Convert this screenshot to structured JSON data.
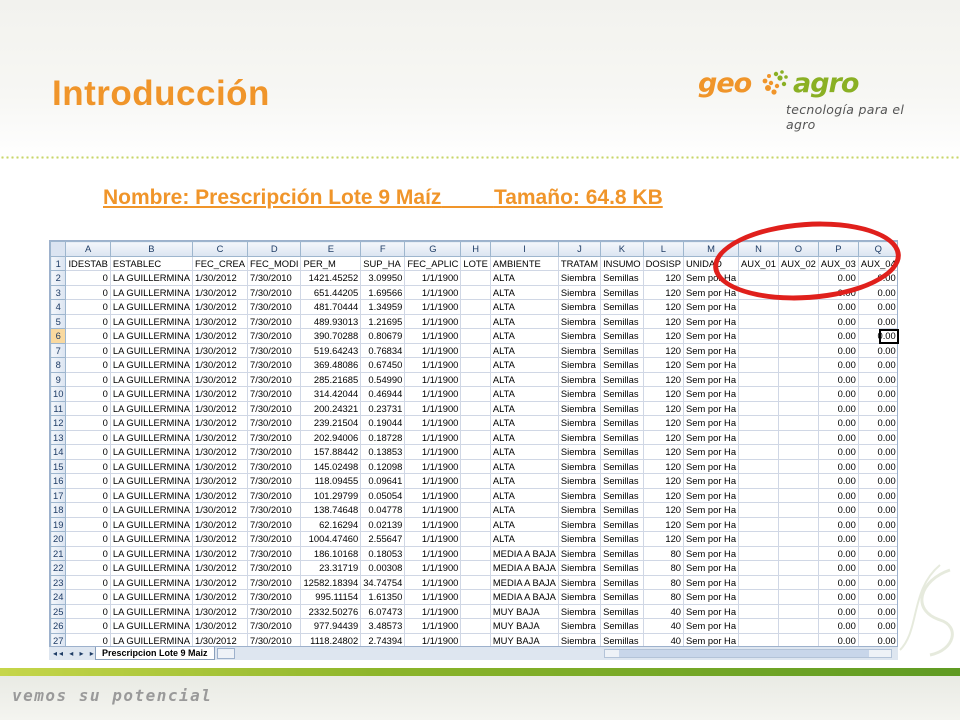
{
  "slide": {
    "title": "Introducción",
    "subtitle_name": "Nombre: Prescripción Lote 9 Maíz",
    "subtitle_size": "Tamaño: 64.8 KB",
    "tagline": "vemos su potencial",
    "accent_color": "#f0952a",
    "green_color": "#8ab024",
    "highlight_color": "#e0201c"
  },
  "logo": {
    "geo": "geo",
    "agro": "agro",
    "tagline": "tecnología para el agro",
    "mark_icon": "seed-swirl-icon"
  },
  "sheet": {
    "column_letters": [
      "A",
      "B",
      "C",
      "D",
      "E",
      "F",
      "G",
      "H",
      "I",
      "J",
      "K",
      "L",
      "M",
      "N",
      "O",
      "P",
      "Q"
    ],
    "headers": [
      "IDESTAB",
      "ESTABLEC",
      "FEC_CREA",
      "FEC_MODI",
      "PER_M",
      "SUP_HA",
      "FEC_APLIC",
      "LOTE",
      "AMBIENTE",
      "TRATAM",
      "INSUMO",
      "DOSISP",
      "UNIDAD",
      "AUX_01",
      "AUX_02",
      "AUX_03",
      "AUX_04"
    ],
    "selected_row": "6",
    "rows": [
      [
        "2",
        "0",
        "LA GUILLERMINA",
        "1/30/2012",
        "7/30/2010",
        "1421.45252",
        "3.09950",
        "1/1/1900",
        "",
        "ALTA",
        "Siembra",
        "Semillas",
        "120",
        "Sem por Ha",
        "",
        "",
        "0.00",
        "0.00"
      ],
      [
        "3",
        "0",
        "LA GUILLERMINA",
        "1/30/2012",
        "7/30/2010",
        "651.44205",
        "1.69566",
        "1/1/1900",
        "",
        "ALTA",
        "Siembra",
        "Semillas",
        "120",
        "Sem por Ha",
        "",
        "",
        "0.00",
        "0.00"
      ],
      [
        "4",
        "0",
        "LA GUILLERMINA",
        "1/30/2012",
        "7/30/2010",
        "481.70444",
        "1.34959",
        "1/1/1900",
        "",
        "ALTA",
        "Siembra",
        "Semillas",
        "120",
        "Sem por Ha",
        "",
        "",
        "0.00",
        "0.00"
      ],
      [
        "5",
        "0",
        "LA GUILLERMINA",
        "1/30/2012",
        "7/30/2010",
        "489.93013",
        "1.21695",
        "1/1/1900",
        "",
        "ALTA",
        "Siembra",
        "Semillas",
        "120",
        "Sem por Ha",
        "",
        "",
        "0.00",
        "0.00"
      ],
      [
        "6",
        "0",
        "LA GUILLERMINA",
        "1/30/2012",
        "7/30/2010",
        "390.70288",
        "0.80679",
        "1/1/1900",
        "",
        "ALTA",
        "Siembra",
        "Semillas",
        "120",
        "Sem por Ha",
        "",
        "",
        "0.00",
        "0.00"
      ],
      [
        "7",
        "0",
        "LA GUILLERMINA",
        "1/30/2012",
        "7/30/2010",
        "519.64243",
        "0.76834",
        "1/1/1900",
        "",
        "ALTA",
        "Siembra",
        "Semillas",
        "120",
        "Sem por Ha",
        "",
        "",
        "0.00",
        "0.00"
      ],
      [
        "8",
        "0",
        "LA GUILLERMINA",
        "1/30/2012",
        "7/30/2010",
        "369.48086",
        "0.67450",
        "1/1/1900",
        "",
        "ALTA",
        "Siembra",
        "Semillas",
        "120",
        "Sem por Ha",
        "",
        "",
        "0.00",
        "0.00"
      ],
      [
        "9",
        "0",
        "LA GUILLERMINA",
        "1/30/2012",
        "7/30/2010",
        "285.21685",
        "0.54990",
        "1/1/1900",
        "",
        "ALTA",
        "Siembra",
        "Semillas",
        "120",
        "Sem por Ha",
        "",
        "",
        "0.00",
        "0.00"
      ],
      [
        "10",
        "0",
        "LA GUILLERMINA",
        "1/30/2012",
        "7/30/2010",
        "314.42044",
        "0.46944",
        "1/1/1900",
        "",
        "ALTA",
        "Siembra",
        "Semillas",
        "120",
        "Sem por Ha",
        "",
        "",
        "0.00",
        "0.00"
      ],
      [
        "11",
        "0",
        "LA GUILLERMINA",
        "1/30/2012",
        "7/30/2010",
        "200.24321",
        "0.23731",
        "1/1/1900",
        "",
        "ALTA",
        "Siembra",
        "Semillas",
        "120",
        "Sem por Ha",
        "",
        "",
        "0.00",
        "0.00"
      ],
      [
        "12",
        "0",
        "LA GUILLERMINA",
        "1/30/2012",
        "7/30/2010",
        "239.21504",
        "0.19044",
        "1/1/1900",
        "",
        "ALTA",
        "Siembra",
        "Semillas",
        "120",
        "Sem por Ha",
        "",
        "",
        "0.00",
        "0.00"
      ],
      [
        "13",
        "0",
        "LA GUILLERMINA",
        "1/30/2012",
        "7/30/2010",
        "202.94006",
        "0.18728",
        "1/1/1900",
        "",
        "ALTA",
        "Siembra",
        "Semillas",
        "120",
        "Sem por Ha",
        "",
        "",
        "0.00",
        "0.00"
      ],
      [
        "14",
        "0",
        "LA GUILLERMINA",
        "1/30/2012",
        "7/30/2010",
        "157.88442",
        "0.13853",
        "1/1/1900",
        "",
        "ALTA",
        "Siembra",
        "Semillas",
        "120",
        "Sem por Ha",
        "",
        "",
        "0.00",
        "0.00"
      ],
      [
        "15",
        "0",
        "LA GUILLERMINA",
        "1/30/2012",
        "7/30/2010",
        "145.02498",
        "0.12098",
        "1/1/1900",
        "",
        "ALTA",
        "Siembra",
        "Semillas",
        "120",
        "Sem por Ha",
        "",
        "",
        "0.00",
        "0.00"
      ],
      [
        "16",
        "0",
        "LA GUILLERMINA",
        "1/30/2012",
        "7/30/2010",
        "118.09455",
        "0.09641",
        "1/1/1900",
        "",
        "ALTA",
        "Siembra",
        "Semillas",
        "120",
        "Sem por Ha",
        "",
        "",
        "0.00",
        "0.00"
      ],
      [
        "17",
        "0",
        "LA GUILLERMINA",
        "1/30/2012",
        "7/30/2010",
        "101.29799",
        "0.05054",
        "1/1/1900",
        "",
        "ALTA",
        "Siembra",
        "Semillas",
        "120",
        "Sem por Ha",
        "",
        "",
        "0.00",
        "0.00"
      ],
      [
        "18",
        "0",
        "LA GUILLERMINA",
        "1/30/2012",
        "7/30/2010",
        "138.74648",
        "0.04778",
        "1/1/1900",
        "",
        "ALTA",
        "Siembra",
        "Semillas",
        "120",
        "Sem por Ha",
        "",
        "",
        "0.00",
        "0.00"
      ],
      [
        "19",
        "0",
        "LA GUILLERMINA",
        "1/30/2012",
        "7/30/2010",
        "62.16294",
        "0.02139",
        "1/1/1900",
        "",
        "ALTA",
        "Siembra",
        "Semillas",
        "120",
        "Sem por Ha",
        "",
        "",
        "0.00",
        "0.00"
      ],
      [
        "20",
        "0",
        "LA GUILLERMINA",
        "1/30/2012",
        "7/30/2010",
        "1004.47460",
        "2.55647",
        "1/1/1900",
        "",
        "ALTA",
        "Siembra",
        "Semillas",
        "120",
        "Sem por Ha",
        "",
        "",
        "0.00",
        "0.00"
      ],
      [
        "21",
        "0",
        "LA GUILLERMINA",
        "1/30/2012",
        "7/30/2010",
        "186.10168",
        "0.18053",
        "1/1/1900",
        "",
        "MEDIA A BAJA",
        "Siembra",
        "Semillas",
        "80",
        "Sem por Ha",
        "",
        "",
        "0.00",
        "0.00"
      ],
      [
        "22",
        "0",
        "LA GUILLERMINA",
        "1/30/2012",
        "7/30/2010",
        "23.31719",
        "0.00308",
        "1/1/1900",
        "",
        "MEDIA A BAJA",
        "Siembra",
        "Semillas",
        "80",
        "Sem por Ha",
        "",
        "",
        "0.00",
        "0.00"
      ],
      [
        "23",
        "0",
        "LA GUILLERMINA",
        "1/30/2012",
        "7/30/2010",
        "12582.18394",
        "34.74754",
        "1/1/1900",
        "",
        "MEDIA A BAJA",
        "Siembra",
        "Semillas",
        "80",
        "Sem por Ha",
        "",
        "",
        "0.00",
        "0.00"
      ],
      [
        "24",
        "0",
        "LA GUILLERMINA",
        "1/30/2012",
        "7/30/2010",
        "995.11154",
        "1.61350",
        "1/1/1900",
        "",
        "MEDIA A BAJA",
        "Siembra",
        "Semillas",
        "80",
        "Sem por Ha",
        "",
        "",
        "0.00",
        "0.00"
      ],
      [
        "25",
        "0",
        "LA GUILLERMINA",
        "1/30/2012",
        "7/30/2010",
        "2332.50276",
        "6.07473",
        "1/1/1900",
        "",
        "MUY BAJA",
        "Siembra",
        "Semillas",
        "40",
        "Sem por Ha",
        "",
        "",
        "0.00",
        "0.00"
      ],
      [
        "26",
        "0",
        "LA GUILLERMINA",
        "1/30/2012",
        "7/30/2010",
        "977.94439",
        "3.48573",
        "1/1/1900",
        "",
        "MUY BAJA",
        "Siembra",
        "Semillas",
        "40",
        "Sem por Ha",
        "",
        "",
        "0.00",
        "0.00"
      ],
      [
        "27",
        "0",
        "LA GUILLERMINA",
        "1/30/2012",
        "7/30/2010",
        "1118.24802",
        "2.74394",
        "1/1/1900",
        "",
        "MUY BAJA",
        "Siembra",
        "Semillas",
        "40",
        "Sem por Ha",
        "",
        "",
        "0.00",
        "0.00"
      ]
    ]
  },
  "tabbar": {
    "sheet_tab": "Prescripcion Lote 9 Maiz",
    "nav_icons": "sheet-nav-arrows-icon"
  }
}
